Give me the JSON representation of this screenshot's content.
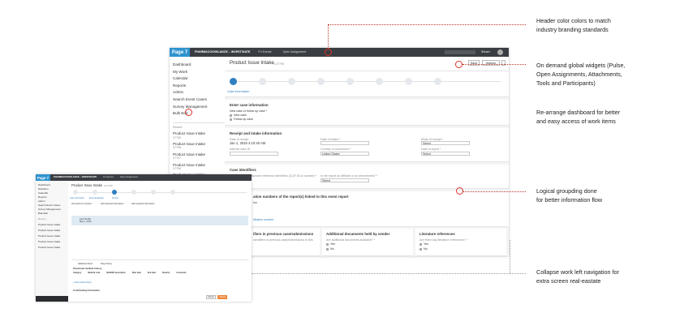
{
  "callouts": [
    "Header color colors to match",
    "industry branding standards",
    "On demand global widgets (Pulse,",
    "Open Assignments, Attachments,",
    "Tools and Participants)",
    "Re-arrange dashboard for better",
    "and easy access  of work items",
    "Logical groupding done",
    "for better information flow",
    "Collapse work left navigation for",
    "extra screen real-eastate"
  ],
  "main": {
    "logo": "Page 7",
    "app_name": "PHARMACOVIGILANCE – INVESTIGATE",
    "tab1": "Pv Events",
    "tab2": "Open Assignment",
    "user": "Sriram",
    "sidebar": [
      "Dashboard",
      "My Work",
      "Calendar",
      "Reports",
      "Admin",
      "Search Event Cases",
      "Survey Management",
      "Bulk Edit"
    ],
    "recent_label": "Recent",
    "recent_items": [
      [
        "Product Issue Intake",
        "27799"
      ],
      [
        "Product Issue Intake",
        "27798"
      ],
      [
        "Product Issue Intake",
        "27797"
      ],
      [
        "Product Issue Intake",
        "27796"
      ],
      [
        "Product Issue Intake",
        "27795"
      ]
    ],
    "page_title": "Product Issue Intake",
    "page_id": "# 27799",
    "btn_save": "Save",
    "btn_actions": "Actions",
    "step1": "Case Information",
    "s1_title": "Enter case information",
    "s1_q": "New case or follow up case *",
    "s1_o1": "New case",
    "s1_o2": "Follow up case",
    "s2_title": "Receipt and intake information",
    "s2_f1": "Date of receipt",
    "s2_v1": "Jan 1, 2015 4:10:40 AM",
    "s2_f2": "Date of intake *",
    "s2_f3": "Mode of receipt *",
    "s2_v3": "Select",
    "s2_f4": "Internal case ID",
    "s2_f5": "Country of occurrence *",
    "s2_v5": "United States",
    "s2_f6": "Date of report *",
    "s2_v6": "Select",
    "s3_title": "Case identifiers",
    "s3_q1": "Have case/manufacturer reference identifiers (CCR ID or number) *",
    "s3_o1": "Yes",
    "s3_o2": "No",
    "s3_q2": "Is the report an Affiliate or an amendment? *",
    "s3_v2": "Select",
    "s4_title": "ation numbers of the report(s) linked to this event report",
    "s4_t2": "ion",
    "s4_t3": "ification number",
    "s5_a": "ifiers in previous case/submissions",
    "s5_a2": "identifiers in previous case/submissions to this",
    "s5_b": "Additional documents held by sender",
    "s5_b2": "Are additional documents available? *",
    "s5_c": "Literature references",
    "s5_c2": "Are there any literature references? *",
    "yes": "Yes",
    "no": "No"
  },
  "secondary": {
    "logo": "Page 7",
    "app_name": "PHARMACOVIGILANCE – INVESTIGATE",
    "tab1": "Pv Events",
    "tab2": "Open Assignment",
    "page_title": "Product Issue Intake",
    "page_id": "# 27799",
    "sidebar": [
      "Dashboard",
      "Workitem",
      "Calendar",
      "Reports",
      "Admin",
      "Search Event Cases",
      "Survey Management",
      "Bulk Edit"
    ],
    "recent_label": "Recent",
    "recent_items": [
      "Product Issue Intake",
      "Product Issue Intake",
      "Product Issue Intake",
      "Product Issue Intake",
      "Product Issue Intake"
    ],
    "steps": [
      "Case information",
      "Event Evaluation",
      "Product"
    ],
    "tabs": [
      "All reports for product",
      "Add required information",
      "Add required information"
    ],
    "record": "Carl Smith",
    "record_sub": "May 1, 2015",
    "sub_tabs": [
      "Additional items",
      "Drug history"
    ],
    "table_title": "Structured medical history",
    "table_cols": [
      "Category",
      "Medical code",
      "MedDRA description",
      "Start date",
      "End date",
      "Severity",
      "Comments"
    ],
    "add_link": "+ Add medical history",
    "section2": "Contributing information",
    "btn_cancel": "Cancel",
    "btn_submit": "Submit"
  },
  "colors": {
    "header": "#3a3d42",
    "logo_bg": "#2f93cf",
    "accent": "#2f7fc1",
    "callout_marker": "#d9332a"
  }
}
